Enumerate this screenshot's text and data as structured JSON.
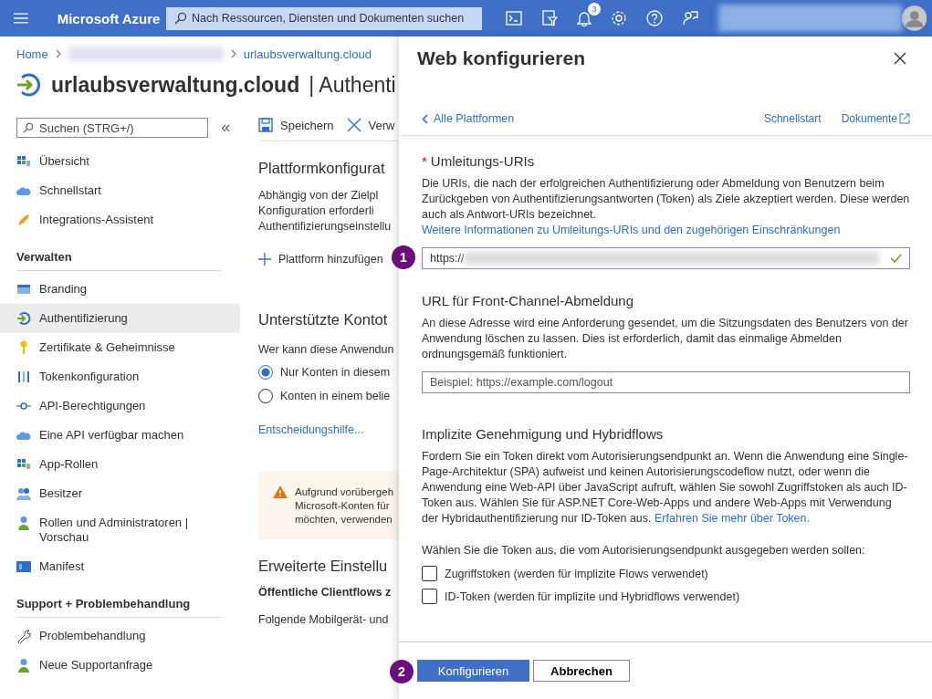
{
  "topbar": {
    "brand": "Microsoft Azure",
    "search_placeholder": "Nach Ressourcen, Diensten und Dokumenten suchen",
    "notification_count": "3"
  },
  "breadcrumb": [
    "Home",
    "urlaubsverwaltung.cloud"
  ],
  "page_title": {
    "name": "urlaubsverwaltung.cloud",
    "suffix": "| Authenti"
  },
  "sidebar": {
    "search_placeholder": "Suchen (STRG+/)",
    "groups": [
      {
        "items": [
          {
            "label": "Übersicht",
            "selected": false
          },
          {
            "label": "Schnellstart",
            "selected": false
          },
          {
            "label": "Integrations-Assistent",
            "selected": false
          }
        ]
      },
      {
        "heading": "Verwalten",
        "items": [
          {
            "label": "Branding",
            "selected": false
          },
          {
            "label": "Authentifizierung",
            "selected": true
          },
          {
            "label": "Zertifikate & Geheimnisse",
            "selected": false
          },
          {
            "label": "Tokenkonfiguration",
            "selected": false
          },
          {
            "label": "API-Berechtigungen",
            "selected": false
          },
          {
            "label": "Eine API verfügbar machen",
            "selected": false
          },
          {
            "label": "App-Rollen",
            "selected": false
          },
          {
            "label": "Besitzer",
            "selected": false
          },
          {
            "label": "Rollen und Administratoren | Vorschau",
            "selected": false
          },
          {
            "label": "Manifest",
            "selected": false
          }
        ]
      },
      {
        "heading": "Support + Problembehandlung",
        "items": [
          {
            "label": "Problembehandlung",
            "selected": false
          },
          {
            "label": "Neue Supportanfrage",
            "selected": false
          }
        ]
      }
    ]
  },
  "content": {
    "toolbar": [
      "Speichern",
      "Verw"
    ],
    "platform_heading": "Plattformkonfigurat",
    "platform_text": [
      "Abhängig von der Zielpl",
      "Konfiguration erforderli",
      "Authentifizierungseinstellu"
    ],
    "add_platform": "Plattform hinzufügen",
    "accounts_heading": "Unterstützte Kontot",
    "accounts_question": "Wer kann diese Anwendun",
    "radios": [
      {
        "label": "Nur Konten in diesem",
        "selected": true
      },
      {
        "label": "Konten in einem belie",
        "selected": false
      }
    ],
    "help_link": "Entscheidungshilfe...",
    "warning": [
      "Aufgrund vorübergeh",
      "Microsoft-Konten für",
      "möchten, verwenden"
    ],
    "advanced_heading": "Erweiterte Einstellu",
    "public_flows": "Öffentliche Clientflows z",
    "mobile_text": "Folgende Mobilgerät- und"
  },
  "panel": {
    "title": "Web konfigurieren",
    "back": "Alle Plattformen",
    "links": [
      "Schnellstart",
      "Dokumente"
    ],
    "redirect": {
      "label": "Umleitungs-URIs",
      "required": true,
      "required_mark": "*",
      "text": "Die URIs, die nach der erfolgreichen Authentifizierung oder Abmeldung von Benutzern beim Zurückgeben von Authentifizierungsantworten (Token) als Ziele akzeptiert werden. Diese werden auch als Antwort-URIs bezeichnet.",
      "link": "Weitere Informationen zu Umleitungs-URIs und den zugehörigen Einschränkungen",
      "value": "https://",
      "valid": true
    },
    "logout": {
      "heading": "URL für Front-Channel-Abmeldung",
      "text": "An diese Adresse wird eine Anforderung gesendet, um die Sitzungsdaten des Benutzers von der Anwendung löschen zu lassen. Dies ist erforderlich, damit das einmalige Abmelden ordnungsgemäß funktioniert.",
      "placeholder": "Beispiel: https://example.com/logout"
    },
    "implicit": {
      "heading": "Implizite Genehmigung und Hybridflows",
      "text": "Fordern Sie ein Token direkt vom Autorisierungsendpunkt an. Wenn die Anwendung eine Single-Page-Architektur (SPA) aufweist und keinen Autorisierungscodeflow nutzt, oder wenn die Anwendung eine Web-API über JavaScript aufruft, wählen Sie sowohl Zugriffstoken als auch ID-Token aus. Wählen Sie für ASP.NET Core-Web-Apps und andere Web-Apps mit Verwendung der Hybridauthentifizierung nur ID-Token aus.",
      "link": "Erfahren Sie mehr über Token.",
      "prompt": "Wählen Sie die Token aus, die vom Autorisierungsendpunkt ausgegeben werden sollen:",
      "options": [
        {
          "label": "Zugriffstoken (werden für implizite Flows verwendet)",
          "checked": false
        },
        {
          "label": "ID-Token (werden für implizite und Hybridflows verwendet)",
          "checked": false
        }
      ]
    },
    "buttons": [
      "Konfigurieren",
      "Abbrechen"
    ]
  },
  "markers": [
    "1",
    "2"
  ]
}
